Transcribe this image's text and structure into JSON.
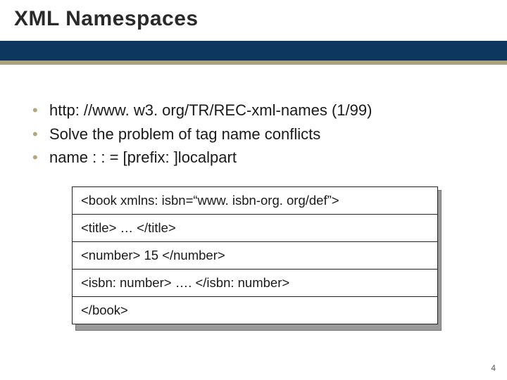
{
  "title": "XML Namespaces",
  "bullets": [
    "http: //www. w3. org/TR/REC-xml-names (1/99)",
    "Solve the problem of tag name conflicts",
    "name : : = [prefix: ]localpart"
  ],
  "code": {
    "l1": "<book xmlns: isbn=“www. isbn-org. org/def”>",
    "l2": "<title> … </title>",
    "l3": "<number> 15 </number>",
    "l4": "<isbn: number> …. </isbn: number>",
    "l5": "</book>"
  },
  "page_number": "4"
}
